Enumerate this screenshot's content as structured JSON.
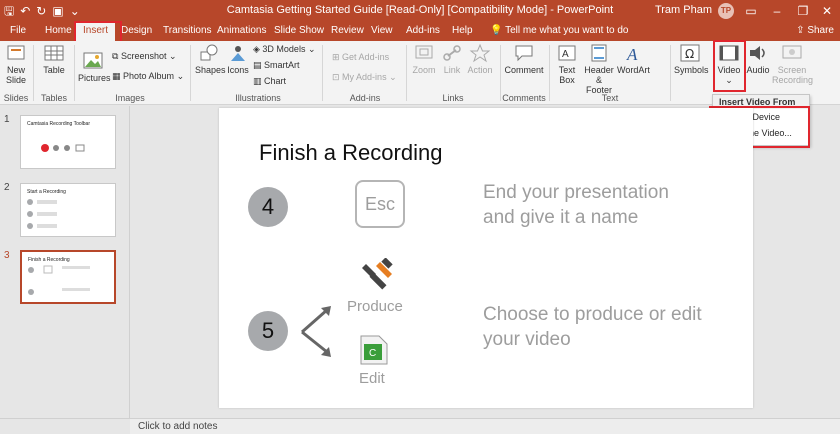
{
  "window": {
    "title": "Camtasia Getting Started Guide [Read-Only] [Compatibility Mode]  -  PowerPoint",
    "user": "Tram Pham",
    "avatar": "TP"
  },
  "tabs": [
    "File",
    "Home",
    "Insert",
    "Design",
    "Transitions",
    "Animations",
    "Slide Show",
    "Review",
    "View",
    "Add-ins",
    "Help"
  ],
  "active_tab": "Insert",
  "tell_me": "Tell me what you want to do",
  "share": "Share",
  "ribbon": {
    "slides": {
      "new_slide": "New",
      "new_slide_2": "Slide",
      "group": "Slides"
    },
    "tables": {
      "table": "Table",
      "group": "Tables"
    },
    "images": {
      "pictures": "Pictures",
      "screenshot": "Screenshot",
      "photo_album": "Photo Album",
      "group": "Images"
    },
    "illustrations": {
      "shapes": "Shapes",
      "icons": "Icons",
      "models": "3D Models",
      "smartart": "SmartArt",
      "chart": "Chart",
      "group": "Illustrations"
    },
    "addins": {
      "get": "Get Add-ins",
      "my": "My Add-ins",
      "group": "Add-ins"
    },
    "links": {
      "zoom": "Zoom",
      "link": "Link",
      "action": "Action",
      "group": "Links"
    },
    "comments": {
      "comment": "Comment",
      "group": "Comments"
    },
    "text": {
      "textbox_1": "Text",
      "textbox_2": "Box",
      "hf_1": "Header",
      "hf_2": "& Footer",
      "wordart": "WordArt",
      "group": "Text"
    },
    "media": {
      "symbols": "Symbols",
      "video": "Video",
      "audio": "Audio",
      "screen_rec_1": "Screen",
      "screen_rec_2": "Recording"
    }
  },
  "video_menu": {
    "title": "Insert Video From",
    "items": [
      "This Device",
      "Online Video..."
    ]
  },
  "thumbnails": [
    {
      "num": "1",
      "title": "Camtasia Recording Toolbar"
    },
    {
      "num": "2",
      "title": "Start a Recording"
    },
    {
      "num": "3",
      "title": "Finish a Recording"
    }
  ],
  "slide": {
    "title": "Finish a Recording",
    "step4": "4",
    "esc": "Esc",
    "text4_line1": "End your presentation",
    "text4_line2": "and give it a name",
    "step5": "5",
    "produce": "Produce",
    "edit": "Edit",
    "text5_line1": "Choose to produce or edit",
    "text5_line2": "your video"
  },
  "notes_placeholder": "Click to add notes",
  "colors": {
    "accent": "#b7472a",
    "highlight": "#e0262e"
  }
}
